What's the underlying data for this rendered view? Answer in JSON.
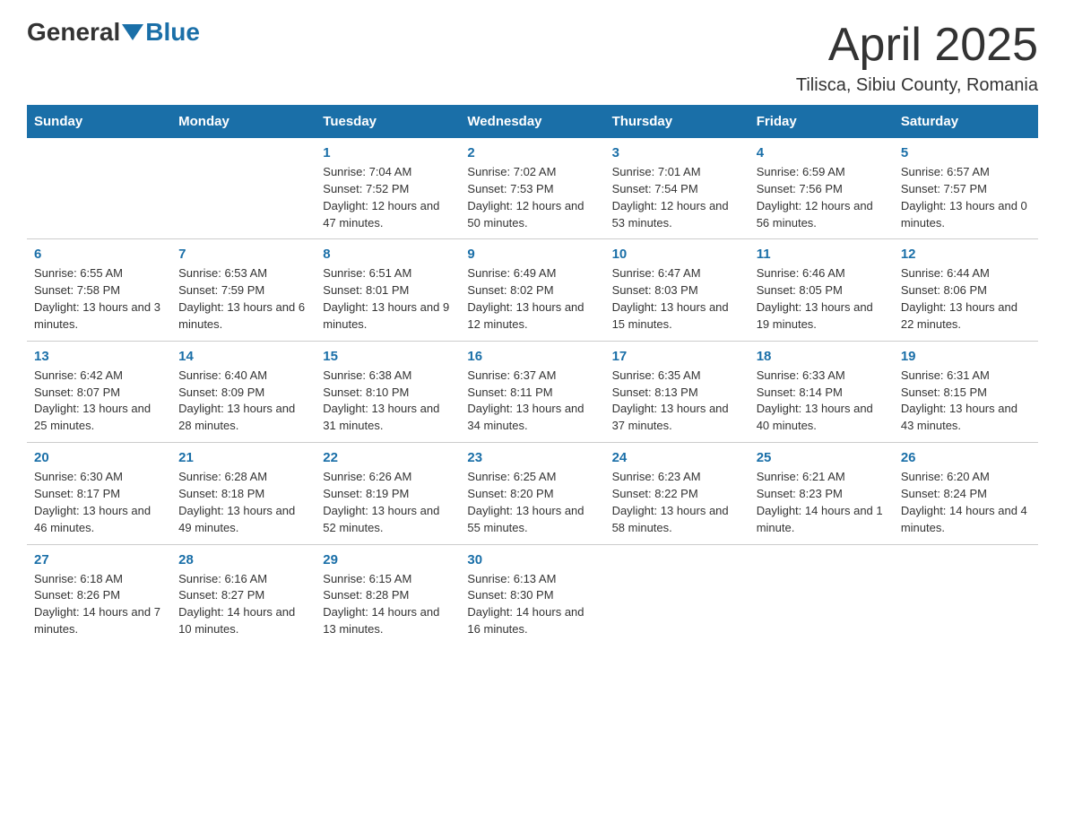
{
  "header": {
    "logo_general": "General",
    "logo_blue": "Blue",
    "month_title": "April 2025",
    "location": "Tilisca, Sibiu County, Romania"
  },
  "weekdays": [
    "Sunday",
    "Monday",
    "Tuesday",
    "Wednesday",
    "Thursday",
    "Friday",
    "Saturday"
  ],
  "weeks": [
    [
      {
        "day": "",
        "sunrise": "",
        "sunset": "",
        "daylight": ""
      },
      {
        "day": "",
        "sunrise": "",
        "sunset": "",
        "daylight": ""
      },
      {
        "day": "1",
        "sunrise": "Sunrise: 7:04 AM",
        "sunset": "Sunset: 7:52 PM",
        "daylight": "Daylight: 12 hours and 47 minutes."
      },
      {
        "day": "2",
        "sunrise": "Sunrise: 7:02 AM",
        "sunset": "Sunset: 7:53 PM",
        "daylight": "Daylight: 12 hours and 50 minutes."
      },
      {
        "day": "3",
        "sunrise": "Sunrise: 7:01 AM",
        "sunset": "Sunset: 7:54 PM",
        "daylight": "Daylight: 12 hours and 53 minutes."
      },
      {
        "day": "4",
        "sunrise": "Sunrise: 6:59 AM",
        "sunset": "Sunset: 7:56 PM",
        "daylight": "Daylight: 12 hours and 56 minutes."
      },
      {
        "day": "5",
        "sunrise": "Sunrise: 6:57 AM",
        "sunset": "Sunset: 7:57 PM",
        "daylight": "Daylight: 13 hours and 0 minutes."
      }
    ],
    [
      {
        "day": "6",
        "sunrise": "Sunrise: 6:55 AM",
        "sunset": "Sunset: 7:58 PM",
        "daylight": "Daylight: 13 hours and 3 minutes."
      },
      {
        "day": "7",
        "sunrise": "Sunrise: 6:53 AM",
        "sunset": "Sunset: 7:59 PM",
        "daylight": "Daylight: 13 hours and 6 minutes."
      },
      {
        "day": "8",
        "sunrise": "Sunrise: 6:51 AM",
        "sunset": "Sunset: 8:01 PM",
        "daylight": "Daylight: 13 hours and 9 minutes."
      },
      {
        "day": "9",
        "sunrise": "Sunrise: 6:49 AM",
        "sunset": "Sunset: 8:02 PM",
        "daylight": "Daylight: 13 hours and 12 minutes."
      },
      {
        "day": "10",
        "sunrise": "Sunrise: 6:47 AM",
        "sunset": "Sunset: 8:03 PM",
        "daylight": "Daylight: 13 hours and 15 minutes."
      },
      {
        "day": "11",
        "sunrise": "Sunrise: 6:46 AM",
        "sunset": "Sunset: 8:05 PM",
        "daylight": "Daylight: 13 hours and 19 minutes."
      },
      {
        "day": "12",
        "sunrise": "Sunrise: 6:44 AM",
        "sunset": "Sunset: 8:06 PM",
        "daylight": "Daylight: 13 hours and 22 minutes."
      }
    ],
    [
      {
        "day": "13",
        "sunrise": "Sunrise: 6:42 AM",
        "sunset": "Sunset: 8:07 PM",
        "daylight": "Daylight: 13 hours and 25 minutes."
      },
      {
        "day": "14",
        "sunrise": "Sunrise: 6:40 AM",
        "sunset": "Sunset: 8:09 PM",
        "daylight": "Daylight: 13 hours and 28 minutes."
      },
      {
        "day": "15",
        "sunrise": "Sunrise: 6:38 AM",
        "sunset": "Sunset: 8:10 PM",
        "daylight": "Daylight: 13 hours and 31 minutes."
      },
      {
        "day": "16",
        "sunrise": "Sunrise: 6:37 AM",
        "sunset": "Sunset: 8:11 PM",
        "daylight": "Daylight: 13 hours and 34 minutes."
      },
      {
        "day": "17",
        "sunrise": "Sunrise: 6:35 AM",
        "sunset": "Sunset: 8:13 PM",
        "daylight": "Daylight: 13 hours and 37 minutes."
      },
      {
        "day": "18",
        "sunrise": "Sunrise: 6:33 AM",
        "sunset": "Sunset: 8:14 PM",
        "daylight": "Daylight: 13 hours and 40 minutes."
      },
      {
        "day": "19",
        "sunrise": "Sunrise: 6:31 AM",
        "sunset": "Sunset: 8:15 PM",
        "daylight": "Daylight: 13 hours and 43 minutes."
      }
    ],
    [
      {
        "day": "20",
        "sunrise": "Sunrise: 6:30 AM",
        "sunset": "Sunset: 8:17 PM",
        "daylight": "Daylight: 13 hours and 46 minutes."
      },
      {
        "day": "21",
        "sunrise": "Sunrise: 6:28 AM",
        "sunset": "Sunset: 8:18 PM",
        "daylight": "Daylight: 13 hours and 49 minutes."
      },
      {
        "day": "22",
        "sunrise": "Sunrise: 6:26 AM",
        "sunset": "Sunset: 8:19 PM",
        "daylight": "Daylight: 13 hours and 52 minutes."
      },
      {
        "day": "23",
        "sunrise": "Sunrise: 6:25 AM",
        "sunset": "Sunset: 8:20 PM",
        "daylight": "Daylight: 13 hours and 55 minutes."
      },
      {
        "day": "24",
        "sunrise": "Sunrise: 6:23 AM",
        "sunset": "Sunset: 8:22 PM",
        "daylight": "Daylight: 13 hours and 58 minutes."
      },
      {
        "day": "25",
        "sunrise": "Sunrise: 6:21 AM",
        "sunset": "Sunset: 8:23 PM",
        "daylight": "Daylight: 14 hours and 1 minute."
      },
      {
        "day": "26",
        "sunrise": "Sunrise: 6:20 AM",
        "sunset": "Sunset: 8:24 PM",
        "daylight": "Daylight: 14 hours and 4 minutes."
      }
    ],
    [
      {
        "day": "27",
        "sunrise": "Sunrise: 6:18 AM",
        "sunset": "Sunset: 8:26 PM",
        "daylight": "Daylight: 14 hours and 7 minutes."
      },
      {
        "day": "28",
        "sunrise": "Sunrise: 6:16 AM",
        "sunset": "Sunset: 8:27 PM",
        "daylight": "Daylight: 14 hours and 10 minutes."
      },
      {
        "day": "29",
        "sunrise": "Sunrise: 6:15 AM",
        "sunset": "Sunset: 8:28 PM",
        "daylight": "Daylight: 14 hours and 13 minutes."
      },
      {
        "day": "30",
        "sunrise": "Sunrise: 6:13 AM",
        "sunset": "Sunset: 8:30 PM",
        "daylight": "Daylight: 14 hours and 16 minutes."
      },
      {
        "day": "",
        "sunrise": "",
        "sunset": "",
        "daylight": ""
      },
      {
        "day": "",
        "sunrise": "",
        "sunset": "",
        "daylight": ""
      },
      {
        "day": "",
        "sunrise": "",
        "sunset": "",
        "daylight": ""
      }
    ]
  ]
}
